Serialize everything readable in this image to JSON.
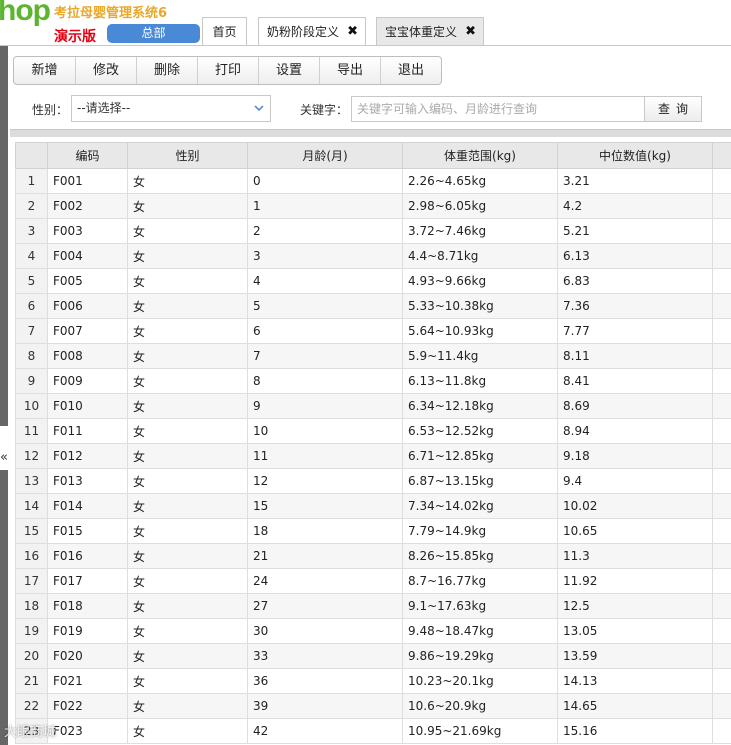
{
  "header": {
    "logo": "hop",
    "app_title": "考拉母婴管理系统6",
    "demo_label": "演示版",
    "hq_button": "总部"
  },
  "tabs": [
    {
      "label": "首页"
    },
    {
      "label": "奶粉阶段定义",
      "close": "✖"
    },
    {
      "label": "宝宝体重定义",
      "close": "✖"
    }
  ],
  "sidebar": {
    "toggle": "«"
  },
  "toolbar": {
    "buttons": [
      "新增",
      "修改",
      "删除",
      "打印",
      "设置",
      "导出",
      "退出"
    ]
  },
  "filters": {
    "gender_label": "性别：",
    "gender_value": "--请选择--",
    "keyword_label": "关键字：",
    "keyword_placeholder": "关键字可输入编码、月龄进行查询",
    "query_button": "查询"
  },
  "table": {
    "columns": [
      "编码",
      "性别",
      "月龄(月)",
      "体重范围(kg)",
      "中位数值(kg)"
    ],
    "rows": [
      [
        "1",
        "F001",
        "女",
        "0",
        "2.26~4.65kg",
        "3.21"
      ],
      [
        "2",
        "F002",
        "女",
        "1",
        "2.98~6.05kg",
        "4.2"
      ],
      [
        "3",
        "F003",
        "女",
        "2",
        "3.72~7.46kg",
        "5.21"
      ],
      [
        "4",
        "F004",
        "女",
        "3",
        "4.4~8.71kg",
        "6.13"
      ],
      [
        "5",
        "F005",
        "女",
        "4",
        "4.93~9.66kg",
        "6.83"
      ],
      [
        "6",
        "F006",
        "女",
        "5",
        "5.33~10.38kg",
        "7.36"
      ],
      [
        "7",
        "F007",
        "女",
        "6",
        "5.64~10.93kg",
        "7.77"
      ],
      [
        "8",
        "F008",
        "女",
        "7",
        "5.9~11.4kg",
        "8.11"
      ],
      [
        "9",
        "F009",
        "女",
        "8",
        "6.13~11.8kg",
        "8.41"
      ],
      [
        "10",
        "F010",
        "女",
        "9",
        "6.34~12.18kg",
        "8.69"
      ],
      [
        "11",
        "F011",
        "女",
        "10",
        "6.53~12.52kg",
        "8.94"
      ],
      [
        "12",
        "F012",
        "女",
        "11",
        "6.71~12.85kg",
        "9.18"
      ],
      [
        "13",
        "F013",
        "女",
        "12",
        "6.87~13.15kg",
        "9.4"
      ],
      [
        "14",
        "F014",
        "女",
        "15",
        "7.34~14.02kg",
        "10.02"
      ],
      [
        "15",
        "F015",
        "女",
        "18",
        "7.79~14.9kg",
        "10.65"
      ],
      [
        "16",
        "F016",
        "女",
        "21",
        "8.26~15.85kg",
        "11.3"
      ],
      [
        "17",
        "F017",
        "女",
        "24",
        "8.7~16.77kg",
        "11.92"
      ],
      [
        "18",
        "F018",
        "女",
        "27",
        "9.1~17.63kg",
        "12.5"
      ],
      [
        "19",
        "F019",
        "女",
        "30",
        "9.48~18.47kg",
        "13.05"
      ],
      [
        "20",
        "F020",
        "女",
        "33",
        "9.86~19.29kg",
        "13.59"
      ],
      [
        "21",
        "F021",
        "女",
        "36",
        "10.23~20.1kg",
        "14.13"
      ],
      [
        "22",
        "F022",
        "女",
        "39",
        "10.6~20.9kg",
        "14.65"
      ],
      [
        "23",
        "F023",
        "女",
        "42",
        "10.95~21.69kg",
        "15.16"
      ]
    ]
  },
  "watermark": "大眼商城",
  "colors": {
    "logo_green": "#5bb52f",
    "title_orange": "#e8a82a",
    "demo_red": "#e60012",
    "hq_blue": "#4a89d6"
  }
}
